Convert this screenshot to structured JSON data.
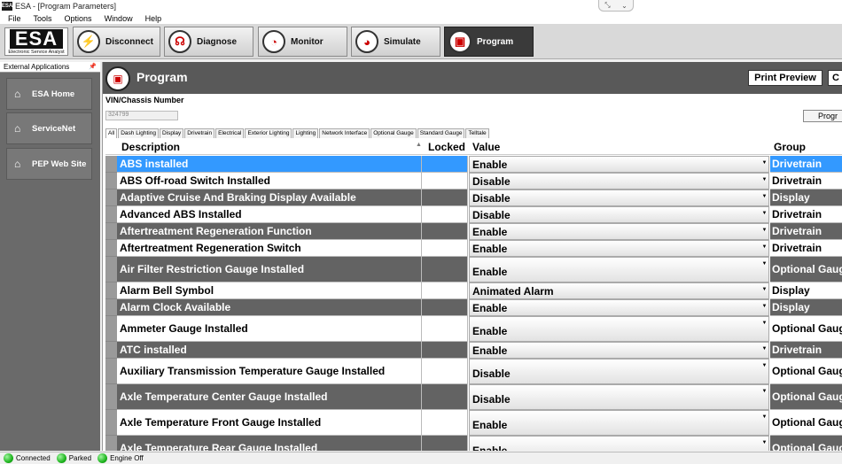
{
  "window": {
    "title": "ESA - [Program Parameters]"
  },
  "menu": [
    "File",
    "Tools",
    "Options",
    "Window",
    "Help"
  ],
  "logo": {
    "main": "ESA",
    "sub": "Electronic Service Analyst"
  },
  "toolbar": {
    "disconnect": "Disconnect",
    "diagnose": "Diagnose",
    "monitor": "Monitor",
    "simulate": "Simulate",
    "program": "Program"
  },
  "sidebar": {
    "header": "External Applications",
    "items": [
      {
        "label": "ESA Home"
      },
      {
        "label": "ServiceNet"
      },
      {
        "label": "PEP Web Site"
      }
    ]
  },
  "main": {
    "title": "Program",
    "print_preview": "Print Preview",
    "c_button": "C",
    "program_button": "Progr",
    "vin_label": "VIN/Chassis Number",
    "vin_value": "324799"
  },
  "tabs": [
    "All",
    "Dash Lighting",
    "Display",
    "Drivetrain",
    "Electrical",
    "Exterior Lighting",
    "Lighting",
    "Network Interface",
    "Optional Gauge",
    "Standard Gauge",
    "Telltale"
  ],
  "table": {
    "headers": {
      "description": "Description",
      "locked": "Locked",
      "value": "Value",
      "group": "Group"
    },
    "rows": [
      {
        "description": "ABS installed",
        "value": "Enable",
        "group": "Drivetrain"
      },
      {
        "description": "ABS Off-road Switch Installed",
        "value": "Disable",
        "group": "Drivetrain"
      },
      {
        "description": "Adaptive Cruise And Braking Display Available",
        "value": "Disable",
        "group": "Display"
      },
      {
        "description": "Advanced ABS Installed",
        "value": "Disable",
        "group": "Drivetrain"
      },
      {
        "description": "Aftertreatment Regeneration Function",
        "value": "Enable",
        "group": "Drivetrain"
      },
      {
        "description": "Aftertreatment Regeneration Switch",
        "value": "Enable",
        "group": "Drivetrain"
      },
      {
        "description": "Air Filter Restriction Gauge Installed",
        "value": "Enable",
        "group": "Optional Gauge"
      },
      {
        "description": "Alarm Bell Symbol",
        "value": "Animated Alarm",
        "group": "Display"
      },
      {
        "description": "Alarm Clock Available",
        "value": "Enable",
        "group": "Display"
      },
      {
        "description": "Ammeter Gauge Installed",
        "value": "Enable",
        "group": "Optional Gauge"
      },
      {
        "description": "ATC installed",
        "value": "Enable",
        "group": "Drivetrain"
      },
      {
        "description": "Auxiliary Transmission Temperature Gauge Installed",
        "value": "Disable",
        "group": "Optional Gauge"
      },
      {
        "description": "Axle Temperature Center Gauge Installed",
        "value": "Disable",
        "group": "Optional Gauge"
      },
      {
        "description": "Axle Temperature Front Gauge Installed",
        "value": "Enable",
        "group": "Optional Gauge"
      },
      {
        "description": "Axle Temperature Rear Gauge Installed",
        "value": "Enable",
        "group": "Optional Gauge"
      }
    ]
  },
  "status": [
    "Connected",
    "Parked",
    "Engine Off"
  ]
}
